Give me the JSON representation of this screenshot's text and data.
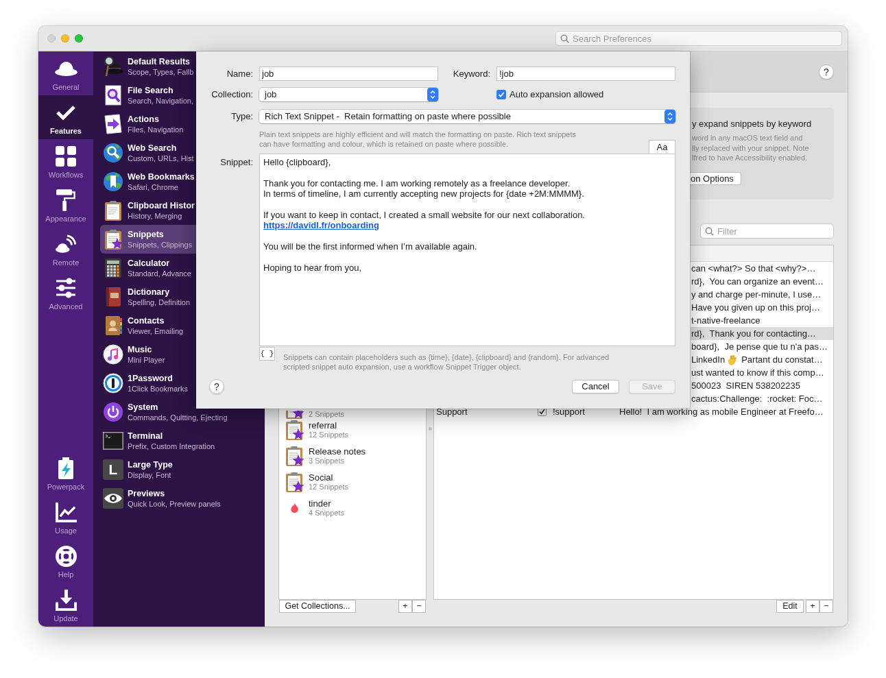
{
  "window": {
    "traffic_lights": [
      {
        "kind": "close",
        "disabled": true
      },
      {
        "kind": "minimize",
        "disabled": false
      },
      {
        "kind": "zoom",
        "disabled": false
      }
    ],
    "search": {
      "placeholder": "Search Preferences"
    }
  },
  "sidebar": {
    "items": [
      {
        "label": "General",
        "kind": "hat",
        "selected": false
      },
      {
        "label": "Features",
        "kind": "check",
        "selected": true
      },
      {
        "label": "Workflows",
        "kind": "grid",
        "selected": false
      },
      {
        "label": "Appearance",
        "kind": "roller",
        "selected": false
      },
      {
        "label": "Remote",
        "kind": "remote",
        "selected": false
      },
      {
        "label": "Advanced",
        "kind": "sliders",
        "selected": false
      }
    ],
    "bottom_items": [
      {
        "label": "Powerpack",
        "kind": "battery",
        "selected": false
      },
      {
        "label": "Usage",
        "kind": "chart",
        "selected": false
      },
      {
        "label": "Help",
        "kind": "lifebuoy",
        "selected": false
      },
      {
        "label": "Update",
        "kind": "download",
        "selected": false
      }
    ]
  },
  "features": {
    "items": [
      {
        "title": "Default Results",
        "subtitle": "Scope, Types, Fallb",
        "kind": "hat",
        "selected": false
      },
      {
        "title": "File Search",
        "subtitle": "Search, Navigation,",
        "kind": "doc-search",
        "selected": false
      },
      {
        "title": "Actions",
        "subtitle": "Files, Navigation",
        "kind": "arrow-page",
        "selected": false
      },
      {
        "title": "Web Search",
        "subtitle": "Custom, URLs, Hist",
        "kind": "globe-search",
        "selected": false
      },
      {
        "title": "Web Bookmarks",
        "subtitle": "Safari, Chrome",
        "kind": "globe-bookmark",
        "selected": false
      },
      {
        "title": "Clipboard Histor",
        "subtitle": "History, Merging",
        "kind": "clipboard",
        "selected": false
      },
      {
        "title": "Snippets",
        "subtitle": "Snippets, Clippings",
        "kind": "clipboard-star",
        "selected": true
      },
      {
        "title": "Calculator",
        "subtitle": "Standard, Advance",
        "kind": "calculator",
        "selected": false
      },
      {
        "title": "Dictionary",
        "subtitle": "Spelling, Definition",
        "kind": "dictionary",
        "selected": false
      },
      {
        "title": "Contacts",
        "subtitle": "Viewer, Emailing",
        "kind": "address-book",
        "selected": false
      },
      {
        "title": "Music",
        "subtitle": "Mini Player",
        "kind": "music",
        "selected": false
      },
      {
        "title": "1Password",
        "subtitle": "1Click Bookmarks",
        "kind": "keyhole",
        "selected": false
      },
      {
        "title": "System",
        "subtitle": "Commands, Quitting, Ejecting",
        "kind": "power",
        "selected": false
      },
      {
        "title": "Terminal",
        "subtitle": "Prefix, Custom Integration",
        "kind": "terminal",
        "selected": false
      },
      {
        "title": "Large Type",
        "subtitle": "Display, Font",
        "kind": "letter",
        "glyph": "L",
        "selected": false
      },
      {
        "title": "Previews",
        "subtitle": "Quick Look, Preview panels",
        "kind": "eye",
        "selected": false
      }
    ]
  },
  "main": {
    "help": "?",
    "info": {
      "title": "y expand snippets by keyword",
      "lines": [
        "word in any macOS text field and",
        "lly replaced with your snippet. Note",
        "lfred to have Accessibility enabled."
      ],
      "button": "on Options"
    },
    "filter": {
      "placeholder": "Filter"
    },
    "collections": {
      "items": [
        {
          "kind": "clipboard-star",
          "count": "2 Snippets"
        },
        {
          "kind": "clipboard-star",
          "name": "referral",
          "count": "12 Snippets"
        },
        {
          "kind": "clipboard-star",
          "name": "Release notes",
          "count": "3 Snippets"
        },
        {
          "kind": "clipboard-star",
          "name": "Social",
          "count": "12 Snippets"
        },
        {
          "kind": "flame",
          "name": "tinder",
          "count": "4 Snippets"
        }
      ],
      "get_button": "Get Collections...",
      "add": "+",
      "remove": "−"
    },
    "snippets": {
      "rows": [
        {
          "kind": "partial",
          "snippet": "can <what?> So that <why?>…",
          "selected": false
        },
        {
          "kind": "partial",
          "snippet": "rd},  You can organize an event…",
          "selected": false
        },
        {
          "kind": "partial",
          "snippet": "y and charge per-minute, I use…",
          "selected": false
        },
        {
          "kind": "partial",
          "snippet": "Have you given up on this proj…",
          "selected": false
        },
        {
          "kind": "partial",
          "snippet": "t-native-freelance",
          "selected": false
        },
        {
          "kind": "partial",
          "snippet": "rd},  Thank you for contacting…",
          "selected": true
        },
        {
          "kind": "partial",
          "snippet": "board},  Je pense que tu n'a pas…",
          "selected": false
        },
        {
          "kind": "partial_emoji",
          "before": "LinkedIn",
          "after": "Partant du constat…",
          "selected": false
        },
        {
          "kind": "partial",
          "snippet": "ust wanted to know if this comp…",
          "selected": false
        },
        {
          "kind": "partial",
          "snippet": "500023  SIREN 538202235",
          "selected": false
        },
        {
          "kind": "partial",
          "snippet": "cactus:Challenge:  :rocket: Foc…",
          "selected": false
        },
        {
          "kind": "full",
          "name": "Support",
          "auto": true,
          "keyword": "!support",
          "snippet": "Hello!  I am working as mobile Engineer at Freefo…",
          "selected": false
        }
      ],
      "edit": "Edit",
      "add": "+",
      "remove": "−"
    }
  },
  "dialog": {
    "name": {
      "label": "Name:",
      "value": "job"
    },
    "keyword": {
      "label": "Keyword:",
      "value": "!job"
    },
    "collection": {
      "label": "Collection:",
      "value": "job"
    },
    "auto_expansion": {
      "label": "Auto expansion allowed",
      "checked": true
    },
    "type": {
      "label": "Type:",
      "value": "Rich Text Snippet -  Retain formatting on paste where possible"
    },
    "type_help": "Plain text snippets are highly efficient and will match the formatting on paste. Rich text snippets can have formatting and colour, which is retained on paste where possible.",
    "format_button": "Aa",
    "snippet": {
      "label": "Snippet:",
      "paragraphs": [
        [
          {
            "kind": "text",
            "text": "Hello {clipboard},"
          }
        ],
        [
          {
            "kind": "text",
            "text": "Thank you for contacting me. I am working remotely as a freelance developer."
          },
          {
            "kind": "text",
            "text": "In terms of timeline, I am currently accepting new projects for {date +2M:MMMM}."
          }
        ],
        [
          {
            "kind": "text",
            "text": "If you want to keep in contact, I created a small website for our next collaboration."
          },
          {
            "kind": "link",
            "text": "https://davidl.fr/onboarding"
          }
        ],
        [
          {
            "kind": "text",
            "text": "You will be the first informed when I’m available again."
          }
        ],
        [
          {
            "kind": "text",
            "text": "Hoping to hear from you,"
          }
        ]
      ]
    },
    "placeholder_button": "{ }",
    "placeholder_help": "Snippets can contain placeholders such as {time}, {date}, {clipboard} and {random}. For advanced scripted snippet auto expansion, use a workflow Snippet Trigger object.",
    "help": "?",
    "cancel": {
      "label": "Cancel",
      "disabled": false
    },
    "save": {
      "label": "Save",
      "disabled": true
    }
  }
}
